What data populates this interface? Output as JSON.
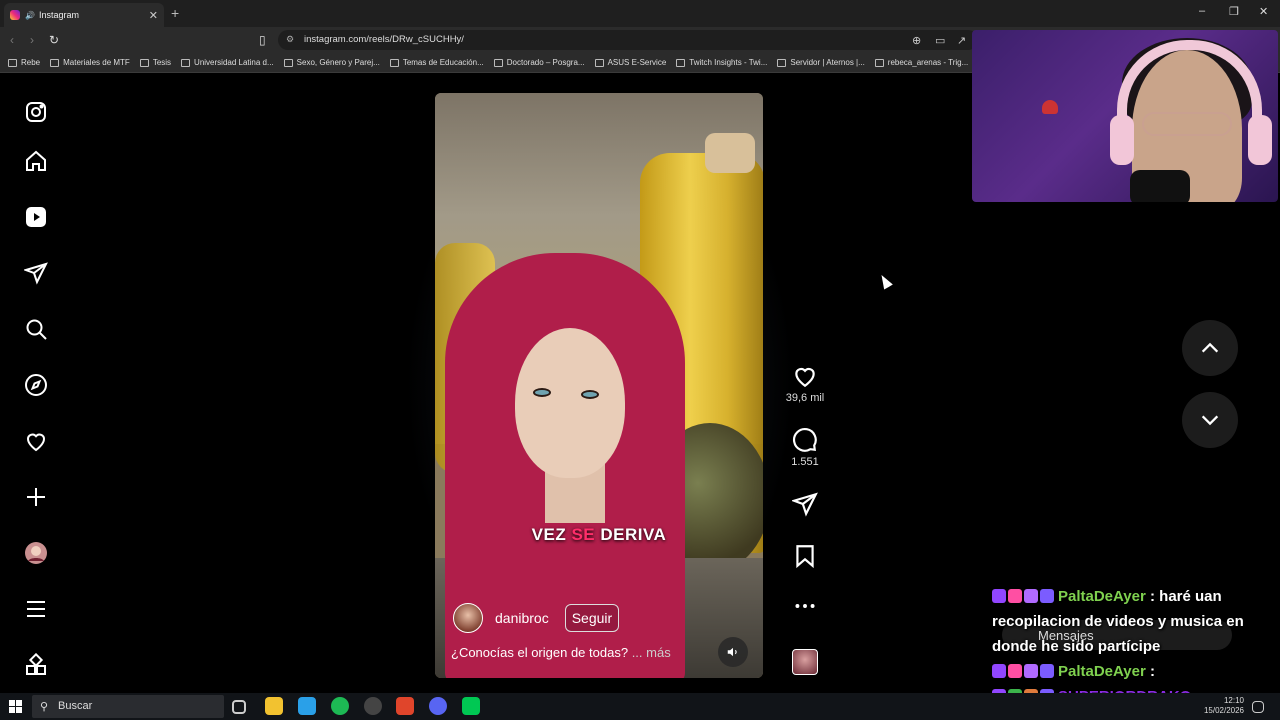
{
  "browser": {
    "tab_title": "Instagram",
    "new_tab": "+",
    "url": "instagram.com/reels/DRw_cSUCHHy/",
    "window_controls": [
      "–",
      "❐",
      "✕"
    ],
    "bookmarks": [
      "Rebe",
      "Materiales de MTF",
      "Tesis",
      "Universidad Latina d...",
      "Sexo, Género y Parej...",
      "Temas de Educación...",
      "Doctorado – Posgra...",
      "ASUS E-Service",
      "Twitch Insights - Twi...",
      "Servidor | Aternos |...",
      "rebeca_arenas - Trig..."
    ]
  },
  "sidebar": {
    "icons": [
      "instagram-logo-icon",
      "home-icon",
      "reels-icon",
      "messages-icon",
      "search-icon",
      "explore-icon",
      "notifications-heart-icon",
      "create-plus-icon",
      "profile-avatar",
      "menu-icon",
      "more-apps-icon"
    ]
  },
  "reel": {
    "caption_parts": [
      "VEZ ",
      "SE",
      " DERIVA"
    ],
    "author": "danibroc",
    "follow_label": "Seguir",
    "description": "¿Conocías el origen de todas?",
    "more_label": "... más"
  },
  "actions": {
    "likes": "39,6 mil",
    "comments": "1.551"
  },
  "chat": {
    "line1_user": "PaltaDeAyer",
    "line1_msg": "haré uan recopilacion de videos y musica en donde he sido partícipe",
    "line2_user": "PaltaDeAyer",
    "line3_user": "SUPERIORDRAKO",
    "messages_label": "Mensajes"
  },
  "taskbar": {
    "search_label": "Buscar",
    "time": "12:10",
    "date": "15/02/2026"
  },
  "colors": {
    "scarf": "#b01e4a",
    "caption_highlight": "#ff2e6a",
    "chat_user_green": "#7fd14f",
    "chat_user_purple": "#8a2be2"
  }
}
